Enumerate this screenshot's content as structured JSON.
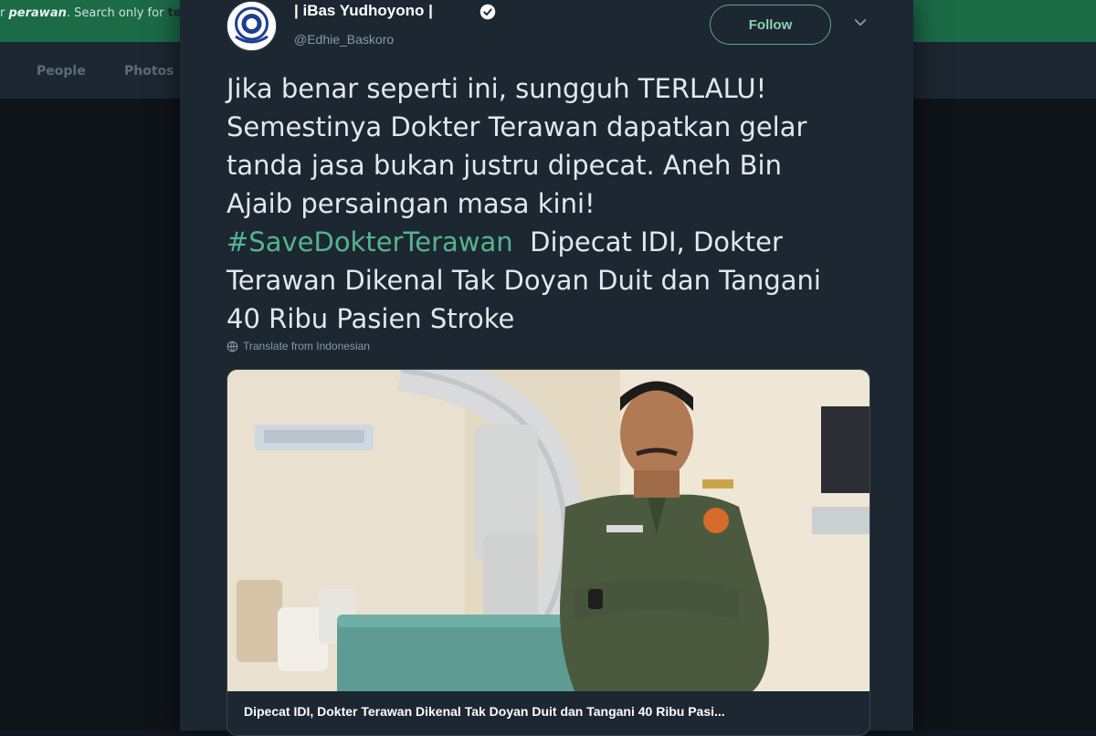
{
  "background": {
    "search_hint_prefix": "r",
    "search_hint_term": "perawan",
    "search_hint_suffix": ". Search only for",
    "search_hint_end": "te",
    "tabs": [
      {
        "label": "People"
      },
      {
        "label": "Photos"
      }
    ]
  },
  "tweet": {
    "display_name": "| iBas Yudhoyono |",
    "handle": "@Edhie_Baskoro",
    "verified": true,
    "follow_label": "Follow",
    "text_lines": [
      "Jika benar seperti ini, sungguh TERLALU!",
      "Semestinya Dokter Terawan dapatkan gelar",
      "tanda jasa bukan justru dipecat. Aneh Bin",
      "Ajaib persaingan masa kini!"
    ],
    "hashtag": "#SaveDokterTerawan",
    "after_hashtag": "  Dipecat IDI, Dokter",
    "text_tail_lines": [
      "Terawan Dikenal Tak Doyan Duit dan Tangani",
      "40 Ribu Pasien Stroke"
    ],
    "translate_label": "Translate from Indonesian",
    "card": {
      "title": "Dipecat IDI, Dokter Terawan Dikenal Tak Doyan Duit dan Tangani 40 Ribu Pasi..."
    }
  },
  "colors": {
    "accent_green": "#55b48d",
    "card_bg": "#1c2732",
    "text": "#e1e8ed",
    "muted": "#8899a6"
  },
  "icons": {
    "verified": "verified-badge-icon",
    "chevron": "chevron-down-icon",
    "translate": "globe-icon"
  }
}
